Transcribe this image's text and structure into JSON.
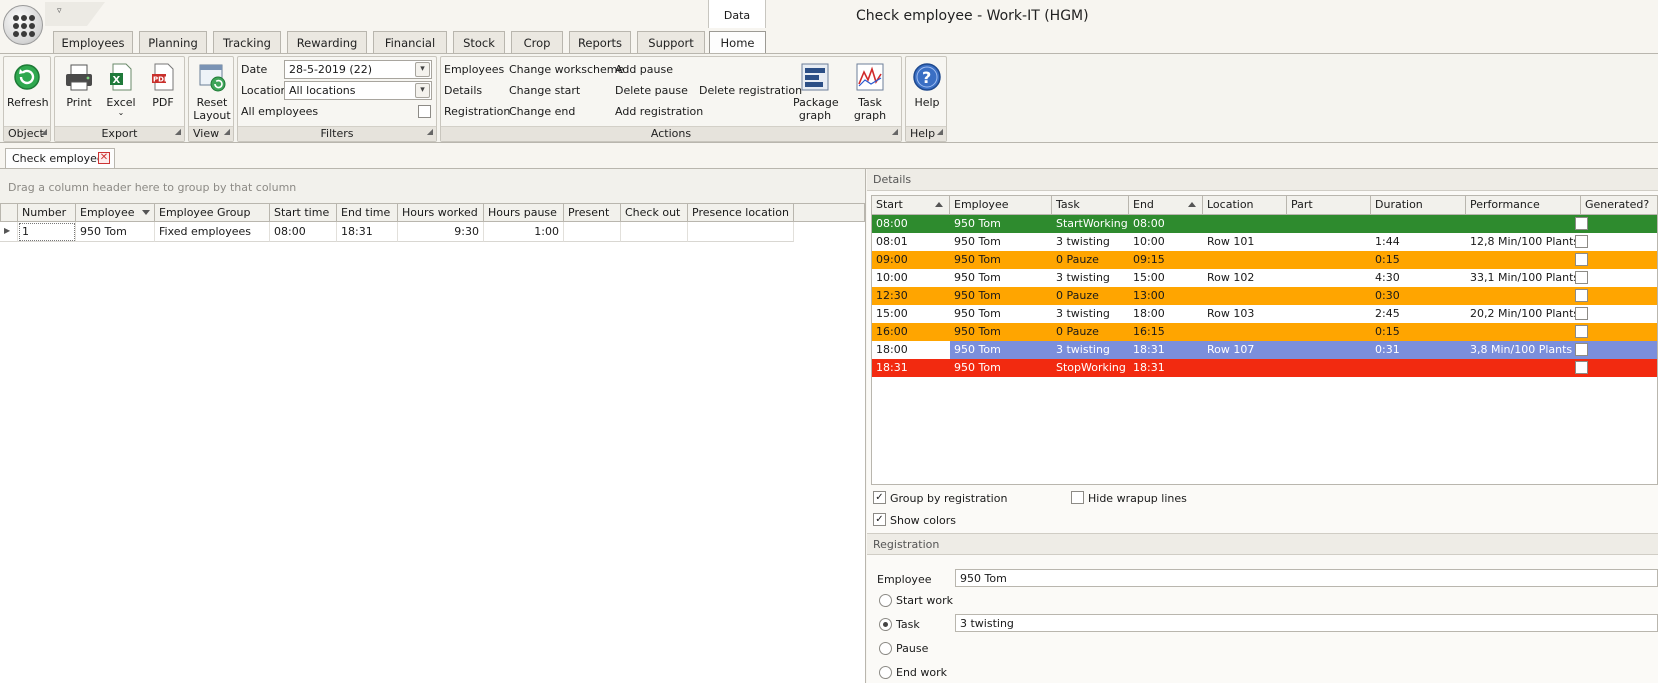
{
  "window": {
    "title": "Check employee - Work-IT (HGM)",
    "context_tab": "Data",
    "quick_access_glyph": "▿"
  },
  "tabs": [
    "Employees",
    "Planning",
    "Tracking",
    "Rewarding",
    "Financial",
    "Stock",
    "Crop",
    "Reports",
    "Support",
    "Home"
  ],
  "active_tab": "Home",
  "ribbon": {
    "object": {
      "label": "Object",
      "refresh": "Refresh"
    },
    "export": {
      "label": "Export",
      "print": "Print",
      "excel": "Excel",
      "pdf": "PDF"
    },
    "view": {
      "label": "View",
      "reset_layout_1": "Reset",
      "reset_layout_2": "Layout"
    },
    "filters": {
      "label": "Filters",
      "date_label": "Date",
      "date_value": "28-5-2019 (22)",
      "location_label": "Location",
      "location_value": "All locations",
      "all_employees_label": "All employees",
      "all_employees_checked": false
    },
    "actions": {
      "label": "Actions",
      "col1": [
        "Employees",
        "Details",
        "Registration"
      ],
      "col2": [
        "Change workscheme",
        "Change start",
        "Change end"
      ],
      "col3": [
        "Add pause",
        "Delete pause",
        "Add registration"
      ],
      "col4": [
        "Delete registration"
      ],
      "package_graph_1": "Package",
      "package_graph_2": "graph",
      "task_graph": "Task graph"
    },
    "help": {
      "label": "Help",
      "button": "Help"
    }
  },
  "document_tab": {
    "label": "Check employee",
    "close_glyph": "✕"
  },
  "left_grid": {
    "group_hint": "Drag a column header here to group by that column",
    "columns": [
      "Number",
      "Employee",
      "Employee Group",
      "Start time",
      "End time",
      "Hours worked",
      "Hours pause",
      "Present",
      "Check out",
      "Presence location"
    ],
    "rows": [
      [
        "1",
        "950 Tom",
        "Fixed employees",
        "08:00",
        "18:31",
        "9:30",
        "1:00",
        "",
        "",
        ""
      ]
    ]
  },
  "details": {
    "title": "Details",
    "columns": [
      "Start",
      "Employee",
      "Task",
      "End",
      "Location",
      "Part",
      "Duration",
      "Performance",
      "Generated?"
    ],
    "rows": [
      {
        "cells": [
          "08:00",
          "950 Tom",
          "StartWorking",
          "08:00",
          "",
          "",
          "",
          ""
        ],
        "color": "#2e8b2e",
        "text": "#ffffff"
      },
      {
        "cells": [
          "08:01",
          "950 Tom",
          "3 twisting",
          "10:00",
          "Row 101",
          "",
          "1:44",
          "12,8 Min/100 Plants"
        ],
        "color": "#ffffff",
        "text": "#1a1a1a"
      },
      {
        "cells": [
          "09:00",
          "950 Tom",
          "0 Pauze",
          "09:15",
          "",
          "",
          "0:15",
          ""
        ],
        "color": "#ffa500",
        "text": "#1a1a1a"
      },
      {
        "cells": [
          "10:00",
          "950 Tom",
          "3 twisting",
          "15:00",
          "Row 102",
          "",
          "4:30",
          "33,1 Min/100 Plants"
        ],
        "color": "#ffffff",
        "text": "#1a1a1a"
      },
      {
        "cells": [
          "12:30",
          "950 Tom",
          "0 Pauze",
          "13:00",
          "",
          "",
          "0:30",
          ""
        ],
        "color": "#ffa500",
        "text": "#1a1a1a"
      },
      {
        "cells": [
          "15:00",
          "950 Tom",
          "3 twisting",
          "18:00",
          "Row 103",
          "",
          "2:45",
          "20,2 Min/100 Plants"
        ],
        "color": "#ffffff",
        "text": "#1a1a1a"
      },
      {
        "cells": [
          "16:00",
          "950 Tom",
          "0 Pauze",
          "16:15",
          "",
          "",
          "0:15",
          ""
        ],
        "color": "#ffa500",
        "text": "#1a1a1a"
      },
      {
        "cells": [
          "18:00",
          "950 Tom",
          "3 twisting",
          "18:31",
          "Row 107",
          "",
          "0:31",
          "3,8 Min/100 Plants"
        ],
        "color": "#7b8fdc",
        "text": "#ffffff",
        "selected": true
      },
      {
        "cells": [
          "18:31",
          "950 Tom",
          "StopWorking",
          "18:31",
          "",
          "",
          "",
          ""
        ],
        "color": "#f22a10",
        "text": "#ffffff"
      }
    ],
    "group_by_registration": "Group by registration",
    "group_by_registration_checked": true,
    "hide_wrapup": "Hide wrapup lines",
    "hide_wrapup_checked": false,
    "show_colors": "Show colors",
    "show_colors_checked": true
  },
  "registration": {
    "title": "Registration",
    "employee_label": "Employee",
    "employee_value": "950 Tom",
    "options": [
      "Start work",
      "Task",
      "Pause",
      "End work"
    ],
    "selected_option": "Task",
    "task_value": "3 twisting"
  },
  "colors": {
    "green": "#2e8b2e",
    "orange": "#ffa500",
    "selected_blue": "#7b8fdc",
    "red": "#f22a10"
  },
  "icons": [
    "app-menu-icon",
    "refresh-icon",
    "print-icon",
    "excel-icon",
    "pdf-icon",
    "reset-layout-icon",
    "package-graph-icon",
    "task-graph-icon",
    "help-icon"
  ]
}
